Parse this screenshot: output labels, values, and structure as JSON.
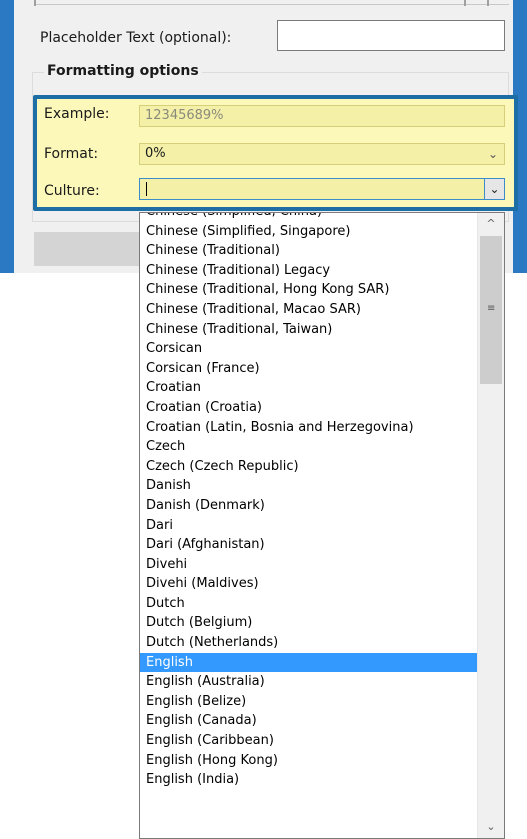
{
  "form": {
    "placeholder_label": "Placeholder Text (optional):",
    "placeholder_value": "",
    "formatting_group_title": "Formatting options",
    "example_label": "Example:",
    "example_value": "12345689%",
    "format_label": "Format:",
    "format_value": "0%",
    "culture_label": "Culture:",
    "culture_value": ""
  },
  "dropdown": {
    "selected_item": "English",
    "items": [
      "Chinese (Simplified, China)",
      "Chinese (Simplified, Singapore)",
      "Chinese (Traditional)",
      "Chinese (Traditional) Legacy",
      "Chinese (Traditional, Hong Kong SAR)",
      "Chinese (Traditional, Macao SAR)",
      "Chinese (Traditional, Taiwan)",
      "Corsican",
      "Corsican (France)",
      "Croatian",
      "Croatian (Croatia)",
      "Croatian (Latin, Bosnia and Herzegovina)",
      "Czech",
      "Czech (Czech Republic)",
      "Danish",
      "Danish (Denmark)",
      "Dari",
      "Dari (Afghanistan)",
      "Divehi",
      "Divehi (Maldives)",
      "Dutch",
      "Dutch (Belgium)",
      "Dutch (Netherlands)",
      "English",
      "English (Australia)",
      "English (Belize)",
      "English (Canada)",
      "English (Caribbean)",
      "English (Hong Kong)",
      "English (India)"
    ]
  },
  "icons": {
    "chevron": "chevron-down-icon",
    "scroll_up": "scroll-up-arrow-icon",
    "scroll_down": "scroll-down-arrow-icon",
    "grip": "scrollbar-grip-icon"
  },
  "colors": {
    "window_frame": "#2b79c2",
    "highlight_fill": "#fbf8b9",
    "highlight_border": "#1c6ea4",
    "selection": "#3399ff"
  }
}
